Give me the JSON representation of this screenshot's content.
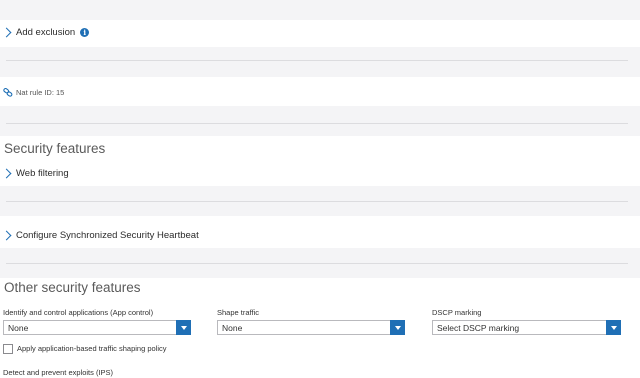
{
  "exclusion": {
    "label": "Add exclusion",
    "info_icon": "info-icon"
  },
  "nat": {
    "label": "Nat rule ID: 15",
    "icon": "link-icon"
  },
  "security_features": {
    "title": "Security features",
    "web_filtering": "Web filtering",
    "heartbeat": "Configure Synchronized Security Heartbeat"
  },
  "other_security": {
    "title": "Other security features",
    "app_control": {
      "label": "Identify and control applications (App control)",
      "value": "None"
    },
    "shape_traffic": {
      "label": "Shape traffic",
      "value": "None"
    },
    "dscp": {
      "label": "DSCP marking",
      "value": "Select DSCP marking"
    },
    "app_shaping_checkbox": {
      "label": "Apply application-based traffic shaping policy",
      "checked": false
    },
    "ips_label": "Detect and prevent exploits (IPS)"
  },
  "colors": {
    "accent": "#1f6fb5",
    "band": "#f4f4f6",
    "divider": "#dcdcdf"
  }
}
